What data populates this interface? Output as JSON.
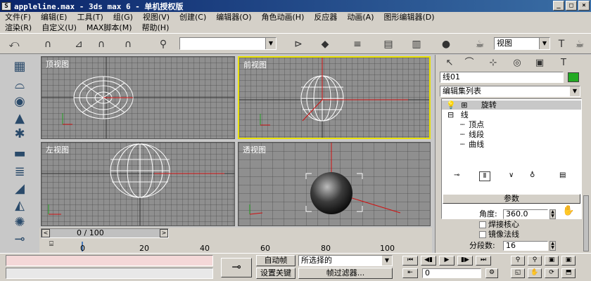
{
  "title": "appleline.max - 3ds max 6 - 单机授权版",
  "window_controls": [
    "_",
    "□",
    "×"
  ],
  "menu_row1": [
    "文件(F)",
    "编辑(E)",
    "工具(T)",
    "组(G)",
    "视图(V)",
    "创建(C)",
    "编辑器(O)",
    "角色动画(H)",
    "反应器",
    "动画(A)",
    "图形编辑器(D)"
  ],
  "menu_row2": [
    "渲染(R)",
    "自定义(U)",
    "MAX脚本(M)",
    "帮助(H)"
  ],
  "toolbar": {
    "view_select": "视图",
    "selection_set": ""
  },
  "viewports": [
    {
      "label": "顶视图"
    },
    {
      "label": "前视图"
    },
    {
      "label": "左视图"
    },
    {
      "label": "透视图"
    }
  ],
  "timeline": {
    "frame_readout": "0 / 100",
    "ticks": [
      "0",
      "20",
      "40",
      "60",
      "80",
      "100"
    ]
  },
  "status": {
    "autokey": "自动帧",
    "setkey": "设置关键点",
    "selection_filter": "所选择的",
    "key_filters": "帧过滤器...",
    "frame_field": "0"
  },
  "command_panel": {
    "object_name": "线01",
    "object_color": "#22aa22",
    "modifier_list": "编辑集列表",
    "stack": [
      "旋转",
      "线",
      "顶点",
      "线段",
      "曲线"
    ],
    "rollout_title": "参数",
    "params": {
      "degrees_label": "角度:",
      "degrees_value": "360.0",
      "weld_core": "焊接核心",
      "flip_normals": "镜像法线",
      "segments_label": "分段数:",
      "segments_value": "16"
    }
  },
  "colors": {
    "title_bar": "#0a246a",
    "viewport_bg": "#8f8f8f",
    "active_viewport_border": "#e8e000",
    "wireframe": "#ffffff",
    "axis_red": "#d01010"
  }
}
